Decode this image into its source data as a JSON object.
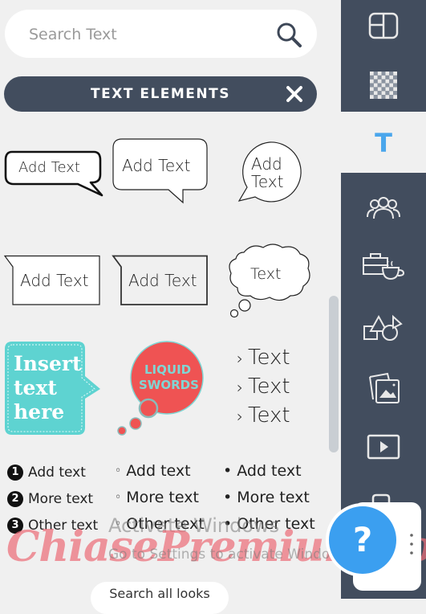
{
  "search": {
    "placeholder": "Search Text",
    "value": "",
    "icon": "search-icon"
  },
  "section": {
    "title": "TEXT ELEMENTS",
    "close_icon": "close-icon"
  },
  "bubbles": [
    {
      "label": "Add Text",
      "style": "hand-drawn-rounded-bubble"
    },
    {
      "label": "Add Text",
      "style": "rounded-rect-bubble"
    },
    {
      "label_line1": "Add",
      "label_line2": "Text",
      "style": "round-bubble"
    },
    {
      "label": "Add Text",
      "style": "rect-tab-bubble"
    },
    {
      "label": "Add Text",
      "style": "rect-tab-bubble-dark"
    },
    {
      "label": "Text",
      "style": "thought-cloud"
    }
  ],
  "styled": {
    "teal": {
      "line1": "Insert",
      "line2": "text",
      "line3": "here",
      "color": "#5ed3d1"
    },
    "liquid": {
      "line1": "LIQUID",
      "line2": "SWORDS",
      "color": "#ef5353",
      "text_color": "#7fd6d4"
    },
    "arrows": [
      "Text",
      "Text",
      "Text"
    ],
    "arrow_glyph": "›"
  },
  "lists": {
    "numbered": [
      {
        "num": "1",
        "text": "Add text"
      },
      {
        "num": "2",
        "text": "More text"
      },
      {
        "num": "3",
        "text": "Other text"
      }
    ],
    "hollow": [
      "Add text",
      "More text",
      "Other text"
    ],
    "filled": [
      "Add text",
      "More text",
      "Other text"
    ],
    "hollow_glyph": "◦",
    "filled_glyph": "•"
  },
  "sidebar": {
    "items": [
      {
        "name": "layouts",
        "icon": "layout-icon"
      },
      {
        "name": "backgrounds",
        "icon": "checkerboard-icon"
      },
      {
        "name": "text",
        "icon": "text-icon",
        "active": true,
        "glyph": "T"
      },
      {
        "name": "people",
        "icon": "people-icon"
      },
      {
        "name": "business",
        "icon": "briefcase-coffee-icon"
      },
      {
        "name": "shapes",
        "icon": "shapes-icon"
      },
      {
        "name": "photos",
        "icon": "photos-icon"
      },
      {
        "name": "videos",
        "icon": "video-icon"
      },
      {
        "name": "devices",
        "icon": "device-icon"
      }
    ],
    "accent": "#4aa6ec",
    "bg": "#424d5e"
  },
  "overlay": {
    "activate_title": "Activate Windows",
    "activate_sub": "Go to Settings to activate Windows.",
    "brand_watermark": "ChiasePremium.com"
  },
  "help": {
    "glyph": "?"
  },
  "footer": {
    "search_all": "Search all looks"
  }
}
